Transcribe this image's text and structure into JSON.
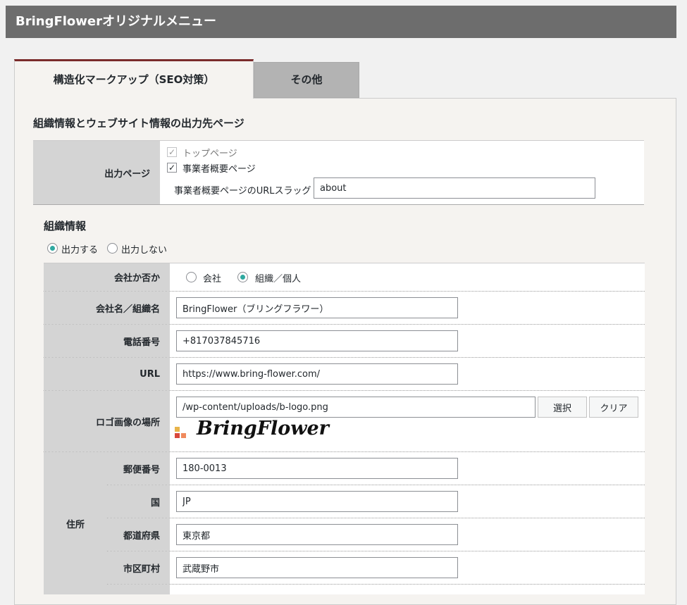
{
  "header": {
    "title": "BringFlowerオリジナルメニュー"
  },
  "tabs": [
    {
      "label": "構造化マークアップ（SEO対策）",
      "active": true
    },
    {
      "label": "その他",
      "active": false
    }
  ],
  "output_section": {
    "title": "組織情報とウェブサイト情報の出力先ページ",
    "row_label": "出力ページ",
    "checkboxes": [
      {
        "label": "トップページ",
        "checked": true,
        "disabled": true
      },
      {
        "label": "事業者概要ページ",
        "checked": true,
        "disabled": false
      }
    ],
    "slug_label": "事業者概要ページのURLスラッグ",
    "slug_value": "about"
  },
  "org_section": {
    "title": "組織情報",
    "output_options": [
      {
        "label": "出力する",
        "selected": true
      },
      {
        "label": "出力しない",
        "selected": false
      }
    ],
    "type_label": "会社か否か",
    "type_options": [
      {
        "label": "会社",
        "selected": false
      },
      {
        "label": "組織／個人",
        "selected": true
      }
    ],
    "name_label": "会社名／組織名",
    "name_value": "BringFlower（ブリングフラワー）",
    "phone_label": "電話番号",
    "phone_value": "+817037845716",
    "url_label": "URL",
    "url_value": "https://www.bring-flower.com/",
    "logo_label": "ロゴ画像の場所",
    "logo_value": "/wp-content/uploads/b-logo.png",
    "select_button": "選択",
    "clear_button": "クリア",
    "logo_text": "BringFlower",
    "address_label": "住所",
    "postal_label": "郵便番号",
    "postal_value": "180-0013",
    "country_label": "国",
    "country_value": "JP",
    "prefecture_label": "都道府県",
    "prefecture_value": "東京都",
    "city_label": "市区町村",
    "city_value": "武蔵野市"
  },
  "colors": {
    "header_bg": "#6d6d6d",
    "active_tab_border": "#7a2b2b",
    "radio_accent": "#2fa9a0"
  }
}
